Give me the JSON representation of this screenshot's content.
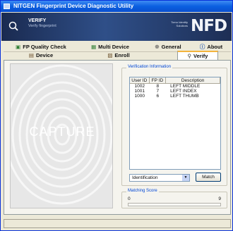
{
  "window": {
    "title": "NITGEN Fingerprint Device Diagnostic Utility"
  },
  "banner": {
    "mode_title": "VERIFY",
    "mode_subtitle": "Verify fingerprint",
    "tiny_text": "Tomo Identity Solutions",
    "logo": "NFD"
  },
  "tabs": [
    {
      "label": "FP Quality Check",
      "icon": "check-icon"
    },
    {
      "label": "Multi Device",
      "icon": "grid-icon"
    },
    {
      "label": "General",
      "icon": "gear-icon"
    },
    {
      "label": "About",
      "icon": "info-icon"
    },
    {
      "label": "Device",
      "icon": "device-icon"
    },
    {
      "label": "Enroll",
      "icon": "enroll-icon"
    },
    {
      "label": "Verify",
      "icon": "magnifier-icon"
    }
  ],
  "capture": {
    "label": "CAPTURE"
  },
  "verification": {
    "group_title": "Verification Information",
    "columns": [
      "User ID",
      "FP ID",
      "Description"
    ],
    "rows": [
      [
        "1002",
        "8",
        "LEFT MIDDLE"
      ],
      [
        "1001",
        "7",
        "LEFT INDEX"
      ],
      [
        "1000",
        "6",
        "LEFT THUMB"
      ]
    ],
    "mode_select": "Identification",
    "match_button": "Match"
  },
  "score": {
    "group_title": "Matching Score",
    "min_label": "0",
    "max_label": "9",
    "value_fraction": 0
  }
}
